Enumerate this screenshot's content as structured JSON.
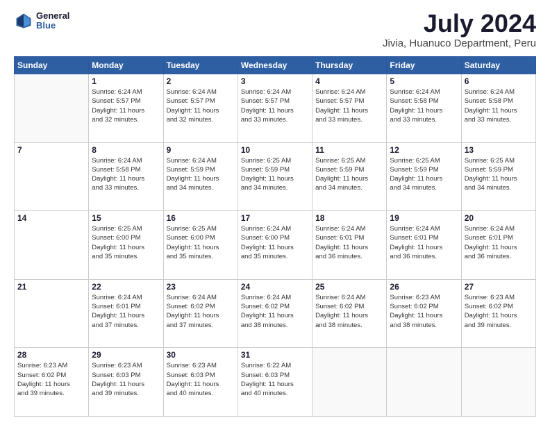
{
  "logo": {
    "line1": "General",
    "line2": "Blue"
  },
  "title": "July 2024",
  "subtitle": "Jivia, Huanuco Department, Peru",
  "days_of_week": [
    "Sunday",
    "Monday",
    "Tuesday",
    "Wednesday",
    "Thursday",
    "Friday",
    "Saturday"
  ],
  "weeks": [
    [
      {
        "day": "",
        "info": ""
      },
      {
        "day": "1",
        "info": "Sunrise: 6:24 AM\nSunset: 5:57 PM\nDaylight: 11 hours\nand 32 minutes."
      },
      {
        "day": "2",
        "info": "Sunrise: 6:24 AM\nSunset: 5:57 PM\nDaylight: 11 hours\nand 32 minutes."
      },
      {
        "day": "3",
        "info": "Sunrise: 6:24 AM\nSunset: 5:57 PM\nDaylight: 11 hours\nand 33 minutes."
      },
      {
        "day": "4",
        "info": "Sunrise: 6:24 AM\nSunset: 5:57 PM\nDaylight: 11 hours\nand 33 minutes."
      },
      {
        "day": "5",
        "info": "Sunrise: 6:24 AM\nSunset: 5:58 PM\nDaylight: 11 hours\nand 33 minutes."
      },
      {
        "day": "6",
        "info": "Sunrise: 6:24 AM\nSunset: 5:58 PM\nDaylight: 11 hours\nand 33 minutes."
      }
    ],
    [
      {
        "day": "7",
        "info": ""
      },
      {
        "day": "8",
        "info": "Sunrise: 6:24 AM\nSunset: 5:58 PM\nDaylight: 11 hours\nand 33 minutes."
      },
      {
        "day": "9",
        "info": "Sunrise: 6:24 AM\nSunset: 5:59 PM\nDaylight: 11 hours\nand 34 minutes."
      },
      {
        "day": "10",
        "info": "Sunrise: 6:25 AM\nSunset: 5:59 PM\nDaylight: 11 hours\nand 34 minutes."
      },
      {
        "day": "11",
        "info": "Sunrise: 6:25 AM\nSunset: 5:59 PM\nDaylight: 11 hours\nand 34 minutes."
      },
      {
        "day": "12",
        "info": "Sunrise: 6:25 AM\nSunset: 5:59 PM\nDaylight: 11 hours\nand 34 minutes."
      },
      {
        "day": "13",
        "info": "Sunrise: 6:25 AM\nSunset: 5:59 PM\nDaylight: 11 hours\nand 34 minutes."
      }
    ],
    [
      {
        "day": "14",
        "info": ""
      },
      {
        "day": "15",
        "info": "Sunrise: 6:25 AM\nSunset: 6:00 PM\nDaylight: 11 hours\nand 35 minutes."
      },
      {
        "day": "16",
        "info": "Sunrise: 6:25 AM\nSunset: 6:00 PM\nDaylight: 11 hours\nand 35 minutes."
      },
      {
        "day": "17",
        "info": "Sunrise: 6:24 AM\nSunset: 6:00 PM\nDaylight: 11 hours\nand 35 minutes."
      },
      {
        "day": "18",
        "info": "Sunrise: 6:24 AM\nSunset: 6:01 PM\nDaylight: 11 hours\nand 36 minutes."
      },
      {
        "day": "19",
        "info": "Sunrise: 6:24 AM\nSunset: 6:01 PM\nDaylight: 11 hours\nand 36 minutes."
      },
      {
        "day": "20",
        "info": "Sunrise: 6:24 AM\nSunset: 6:01 PM\nDaylight: 11 hours\nand 36 minutes."
      }
    ],
    [
      {
        "day": "21",
        "info": ""
      },
      {
        "day": "22",
        "info": "Sunrise: 6:24 AM\nSunset: 6:01 PM\nDaylight: 11 hours\nand 37 minutes."
      },
      {
        "day": "23",
        "info": "Sunrise: 6:24 AM\nSunset: 6:02 PM\nDaylight: 11 hours\nand 37 minutes."
      },
      {
        "day": "24",
        "info": "Sunrise: 6:24 AM\nSunset: 6:02 PM\nDaylight: 11 hours\nand 38 minutes."
      },
      {
        "day": "25",
        "info": "Sunrise: 6:24 AM\nSunset: 6:02 PM\nDaylight: 11 hours\nand 38 minutes."
      },
      {
        "day": "26",
        "info": "Sunrise: 6:23 AM\nSunset: 6:02 PM\nDaylight: 11 hours\nand 38 minutes."
      },
      {
        "day": "27",
        "info": "Sunrise: 6:23 AM\nSunset: 6:02 PM\nDaylight: 11 hours\nand 39 minutes."
      }
    ],
    [
      {
        "day": "28",
        "info": "Sunrise: 6:23 AM\nSunset: 6:02 PM\nDaylight: 11 hours\nand 39 minutes."
      },
      {
        "day": "29",
        "info": "Sunrise: 6:23 AM\nSunset: 6:03 PM\nDaylight: 11 hours\nand 39 minutes."
      },
      {
        "day": "30",
        "info": "Sunrise: 6:23 AM\nSunset: 6:03 PM\nDaylight: 11 hours\nand 40 minutes."
      },
      {
        "day": "31",
        "info": "Sunrise: 6:22 AM\nSunset: 6:03 PM\nDaylight: 11 hours\nand 40 minutes."
      },
      {
        "day": "",
        "info": ""
      },
      {
        "day": "",
        "info": ""
      },
      {
        "day": "",
        "info": ""
      }
    ]
  ]
}
